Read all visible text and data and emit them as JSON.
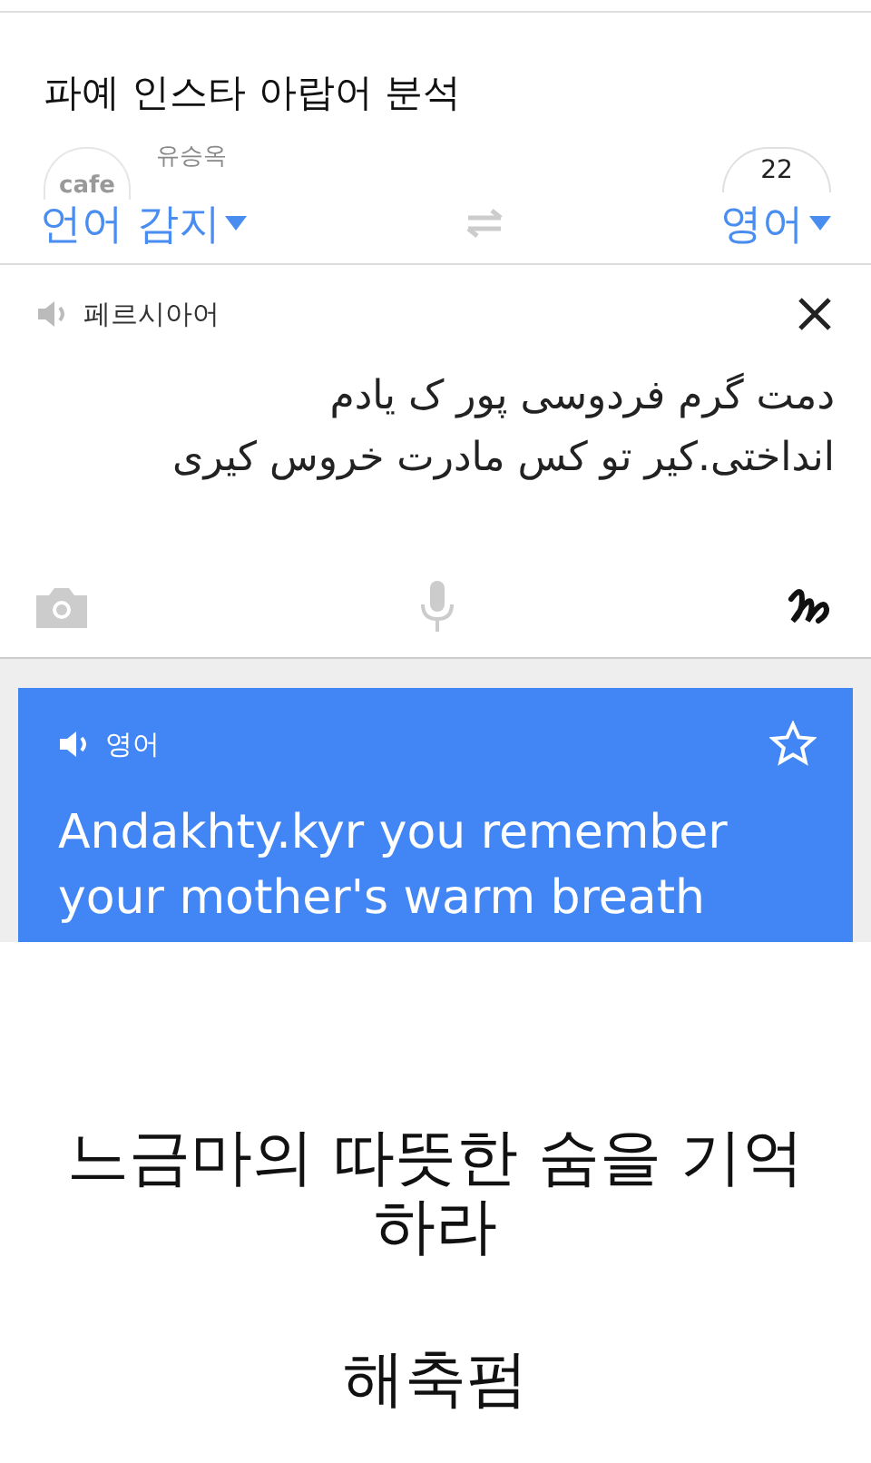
{
  "post": {
    "title": "파예 인스타 아랍어 분석",
    "avatar_label": "cafe",
    "author": "유승옥",
    "comment_count": "22"
  },
  "languages": {
    "source": "언어 감지",
    "target": "영어"
  },
  "input": {
    "language": "페르시아어",
    "text_lines": [
      "دمت گرم فردوسی پور ک یادم",
      "انداختی.کیر تو کس مادرت خروس کیری"
    ]
  },
  "output": {
    "language": "영어",
    "text": "Andakhty.kyr you remember your mother's warm breath",
    "starred": false
  },
  "caption": {
    "text": "느금마의 따뜻한 숨을 기억하라",
    "credit": "해축펌"
  }
}
